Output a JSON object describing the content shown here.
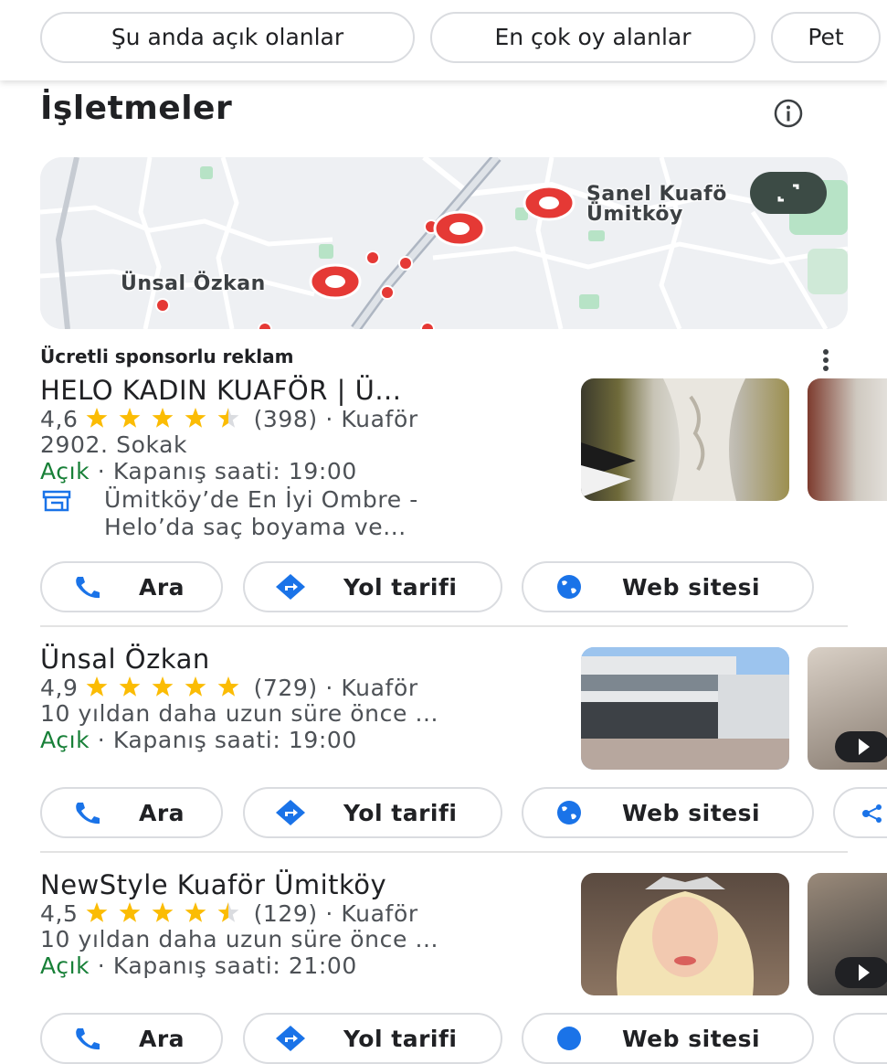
{
  "filter_chips": [
    {
      "label": "Şu anda açık olanlar"
    },
    {
      "label": "En çok oy alanlar"
    },
    {
      "label": "Pet"
    }
  ],
  "section": {
    "title": "İşletmeler"
  },
  "map": {
    "labels": {
      "unsal": "Ünsal Özkan",
      "sanel_line1": "Şanel Kuafö",
      "sanel_line2": "Ümitköy"
    },
    "pin_color": "#e53935"
  },
  "sponsored_label": "Ücretli sponsorlu reklam",
  "listings": [
    {
      "name": "HELO KADIN KUAFÖR | Ü...",
      "rating": "4,6",
      "rating_value": 4.6,
      "reviews": "(398)",
      "category": "· Kuaför",
      "address": "2902. Sokak",
      "open_label": "Açık",
      "hours": "· Kapanış saati: 19:00",
      "promo_line1": "Ümitköy’de En İyi Ombre -",
      "promo_line2": "Helo’da saç boyama ve..."
    },
    {
      "name": "Ünsal Özkan",
      "rating": "4,9",
      "rating_value": 4.9,
      "reviews": "(729)",
      "category": "· Kuaför",
      "address": "10 yıldan daha uzun süre önce ...",
      "open_label": "Açık",
      "hours": "· Kapanış saati: 19:00"
    },
    {
      "name": "NewStyle Kuaför Ümitköy",
      "rating": "4,5",
      "rating_value": 4.5,
      "reviews": "(129)",
      "category": "· Kuaför",
      "address": "10 yıldan daha uzun süre önce ...",
      "open_label": "Açık",
      "hours": "· Kapanış saati: 21:00"
    }
  ],
  "actions": {
    "call": "Ara",
    "directions": "Yol tarifi",
    "website": "Web sitesi"
  },
  "colors": {
    "accent_blue": "#1a73e8",
    "open_green": "#188038",
    "star": "#fbbc04",
    "pin_red": "#e53935"
  }
}
